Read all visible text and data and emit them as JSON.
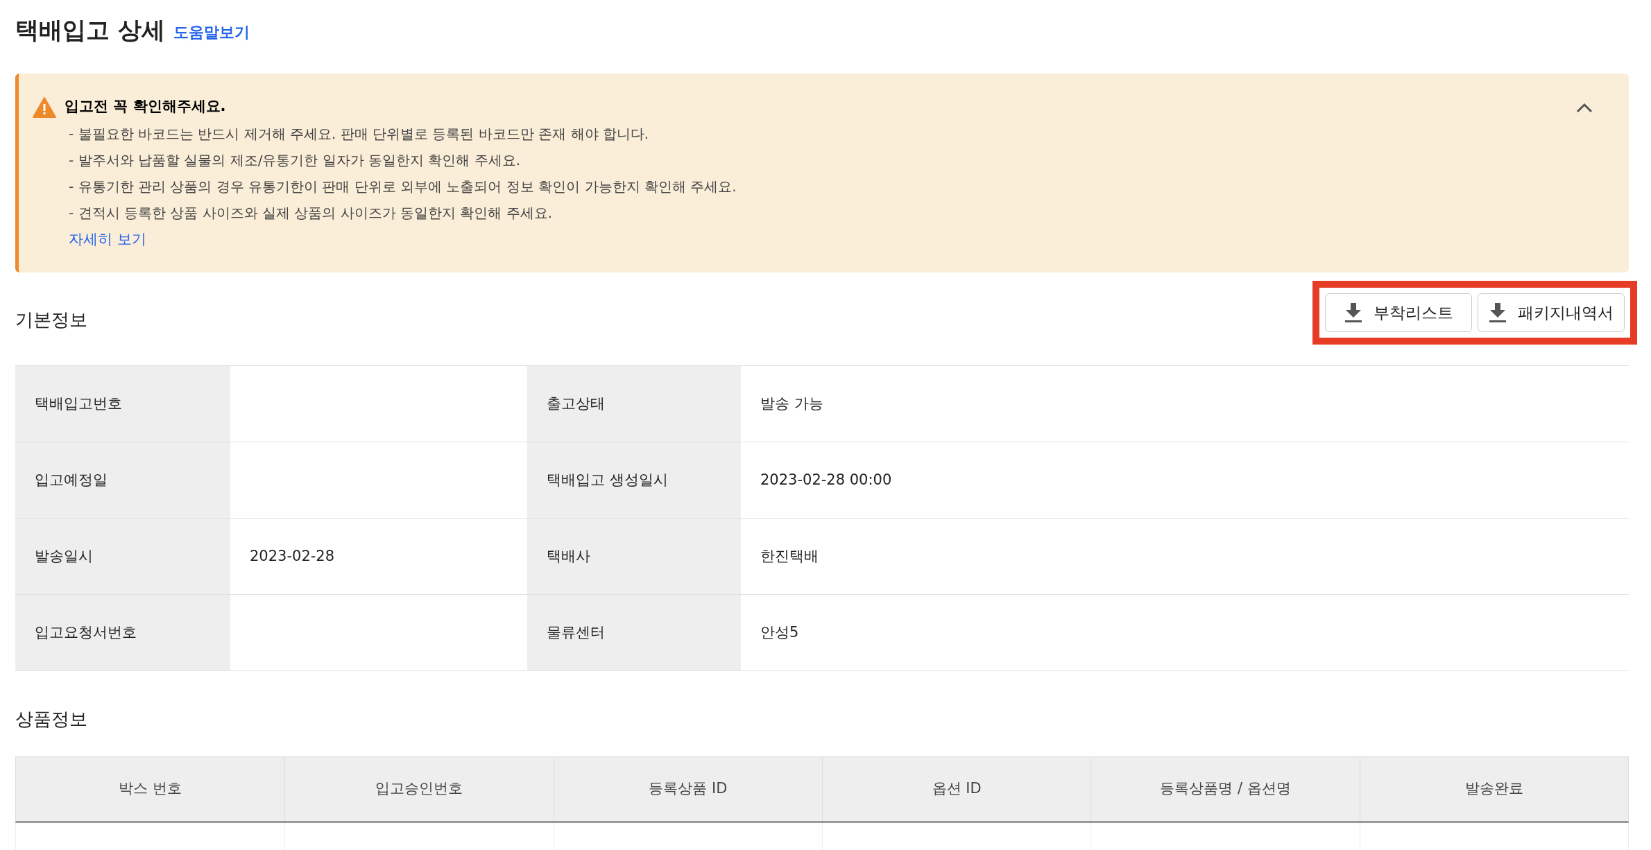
{
  "header": {
    "title": "택배입고 상세",
    "help_link": "도움말보기"
  },
  "notice": {
    "expanded": true,
    "title": "입고전 꼭 확인해주세요.",
    "lines": [
      "- 불필요한 바코드는 반드시 제거해 주세요. 판매 단위별로 등록된 바코드만 존재 해야 합니다.",
      "- 발주서와 납품할 실물의 제조/유통기한 일자가 동일한지 확인해 주세요.",
      "- 유통기한 관리 상품의 경우 유통기한이 판매 단위로 외부에 노출되어 정보 확인이 가능한지 확인해 주세요.",
      "- 견적시 등록한 상품 사이즈와 실제 상품의 사이즈가 동일한지 확인해 주세요."
    ],
    "more_link": "자세히 보기"
  },
  "basic_info": {
    "title": "기본정보",
    "actions_highlighted": true,
    "actions": [
      "부착리스트",
      "패키지내역서"
    ],
    "rows": [
      [
        {
          "label": "택배입고번호"
        },
        {
          "label": "출고상태",
          "value": "발송 가능"
        }
      ],
      [
        {
          "label": "입고예정일"
        },
        {
          "label": "택배입고 생성일시",
          "value": "2023-02-28 00:00"
        }
      ],
      [
        {
          "label": "발송일시",
          "value": "2023-02-28"
        },
        {
          "label": "택배사",
          "value": "한진택배"
        }
      ],
      [
        {
          "label": "입고요청서번호"
        },
        {
          "label": "물류센터",
          "value": "안성5"
        }
      ]
    ]
  },
  "product_info": {
    "title": "상품정보",
    "columns": [
      "박스 번호",
      "입고승인번호",
      "등록상품 ID",
      "옵션 ID",
      "등록상품명 / 옵션명",
      "발송완료"
    ]
  }
}
